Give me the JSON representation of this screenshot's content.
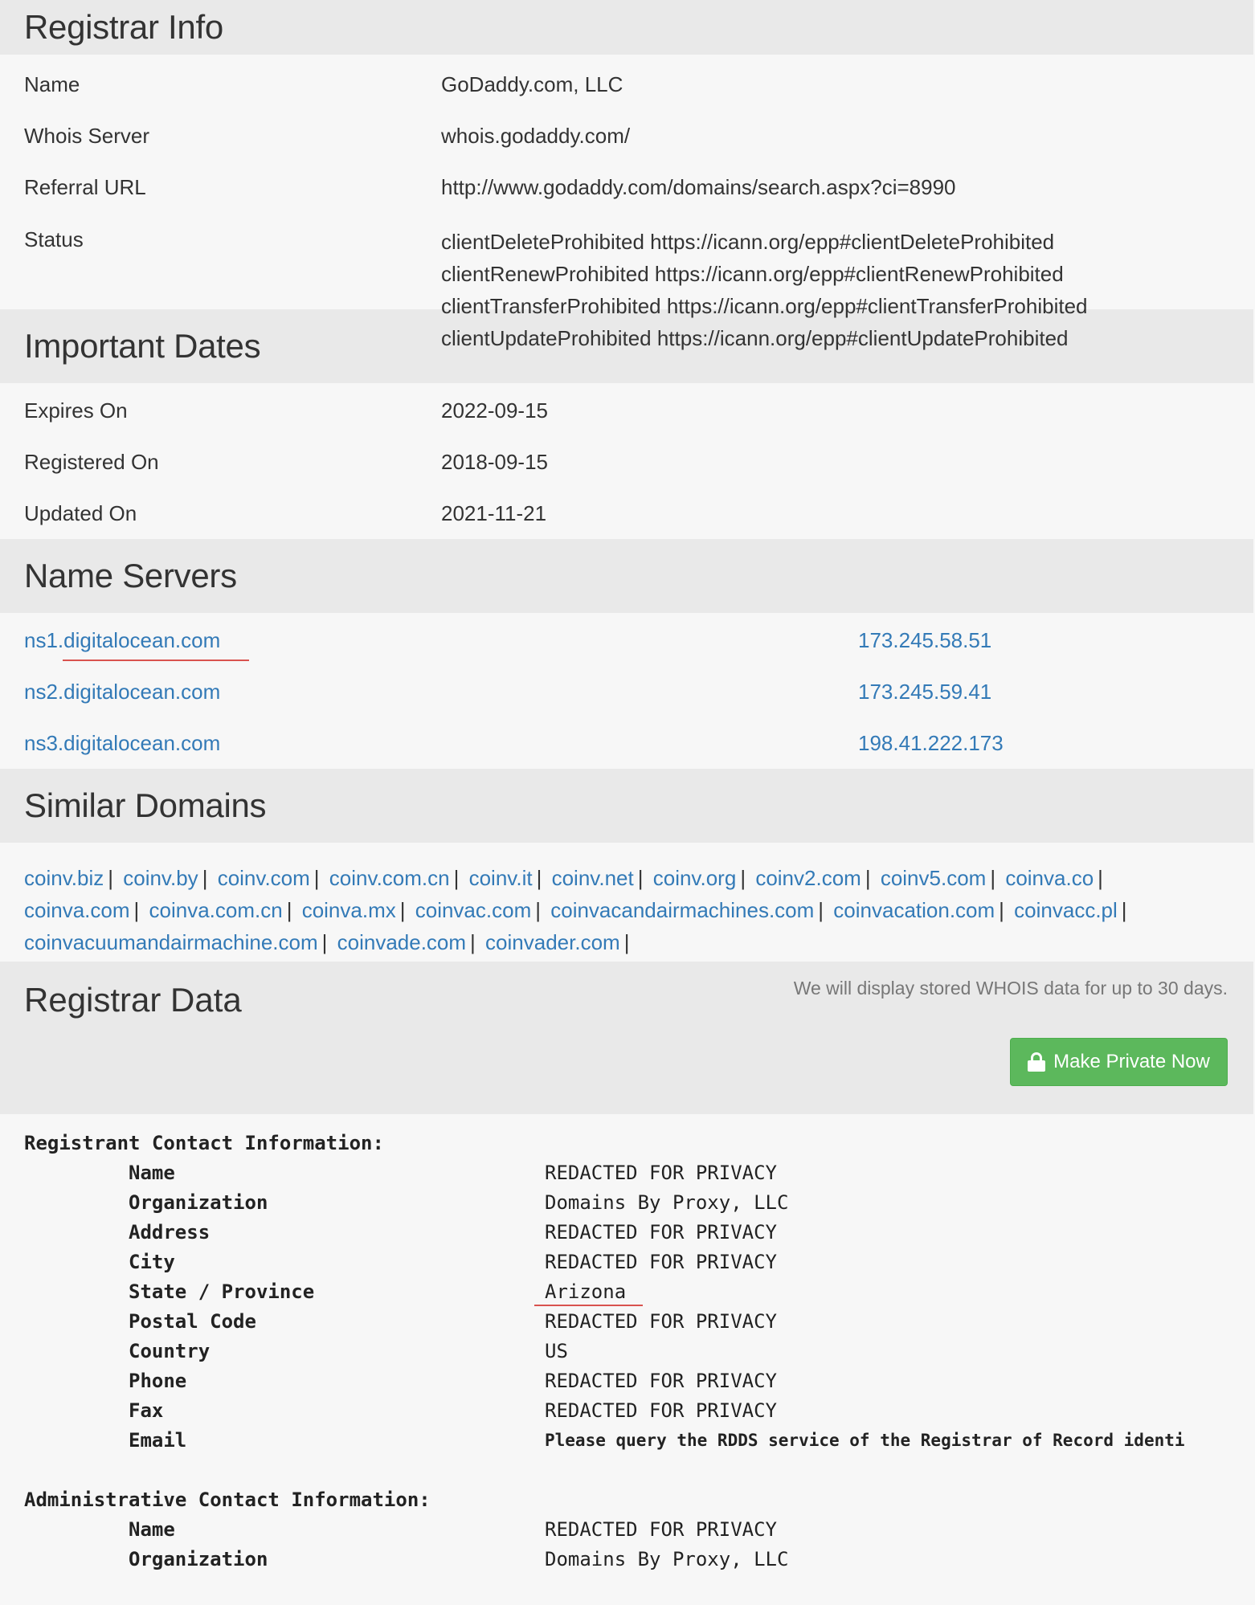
{
  "registrar_info": {
    "title": "Registrar Info",
    "rows": [
      {
        "label": "Name",
        "value": "GoDaddy.com, LLC"
      },
      {
        "label": "Whois Server",
        "value": "whois.godaddy.com/"
      },
      {
        "label": "Referral URL",
        "value": "http://www.godaddy.com/domains/search.aspx?ci=8990"
      }
    ],
    "status_label": "Status",
    "status_lines": [
      "clientDeleteProhibited https://icann.org/epp#clientDeleteProhibited",
      "clientRenewProhibited https://icann.org/epp#clientRenewProhibited",
      "clientTransferProhibited https://icann.org/epp#clientTransferProhibited",
      "clientUpdateProhibited https://icann.org/epp#clientUpdateProhibited"
    ]
  },
  "important_dates": {
    "title": "Important Dates",
    "rows": [
      {
        "label": "Expires On",
        "value": "2022-09-15"
      },
      {
        "label": "Registered On",
        "value": "2018-09-15"
      },
      {
        "label": "Updated On",
        "value": "2021-11-21"
      }
    ]
  },
  "name_servers": {
    "title": "Name Servers",
    "rows": [
      {
        "host": "ns1.digitalocean.com",
        "ip": "173.245.58.51"
      },
      {
        "host": "ns2.digitalocean.com",
        "ip": "173.245.59.41"
      },
      {
        "host": "ns3.digitalocean.com",
        "ip": "198.41.222.173"
      }
    ]
  },
  "similar_domains": {
    "title": "Similar Domains",
    "separator": "|",
    "domains": [
      "coinv.biz",
      "coinv.by",
      "coinv.com",
      "coinv.com.cn",
      "coinv.it",
      "coinv.net",
      "coinv.org",
      "coinv2.com",
      "coinv5.com",
      "coinva.co",
      "coinva.com",
      "coinva.com.cn",
      "coinva.mx",
      "coinvac.com",
      "coinvacandairmachines.com",
      "coinvacation.com",
      "coinvacc.pl",
      "coinvacuumandairmachine.com",
      "coinvade.com",
      "coinvader.com"
    ]
  },
  "registrar_data": {
    "title": "Registrar Data",
    "note": "We will display stored WHOIS data for up to 30 days.",
    "button_label": "Make Private Now",
    "registrant": {
      "title": "Registrant Contact Information:",
      "rows": [
        {
          "label": "Name",
          "value": "REDACTED FOR PRIVACY"
        },
        {
          "label": "Organization",
          "value": "Domains By Proxy, LLC"
        },
        {
          "label": "Address",
          "value": "REDACTED FOR PRIVACY"
        },
        {
          "label": "City",
          "value": "REDACTED FOR PRIVACY"
        },
        {
          "label": "State / Province",
          "value": "Arizona"
        },
        {
          "label": "Postal Code",
          "value": "REDACTED FOR PRIVACY"
        },
        {
          "label": "Country",
          "value": "US"
        },
        {
          "label": "Phone",
          "value": "REDACTED FOR PRIVACY"
        },
        {
          "label": "Fax",
          "value": "REDACTED FOR PRIVACY"
        },
        {
          "label": "Email",
          "value": "Please query the RDDS service of the Registrar of Record identi"
        }
      ]
    },
    "administrative": {
      "title": "Administrative Contact Information:",
      "rows": [
        {
          "label": "Name",
          "value": "REDACTED FOR PRIVACY"
        },
        {
          "label": "Organization",
          "value": "Domains By Proxy, LLC"
        }
      ]
    }
  },
  "colors": {
    "link": "#337ab7",
    "header_bg": "#e9e9e9",
    "body_bg": "#f7f7f7",
    "button_green": "#5cb85c",
    "annotation_red": "#d9534f"
  }
}
